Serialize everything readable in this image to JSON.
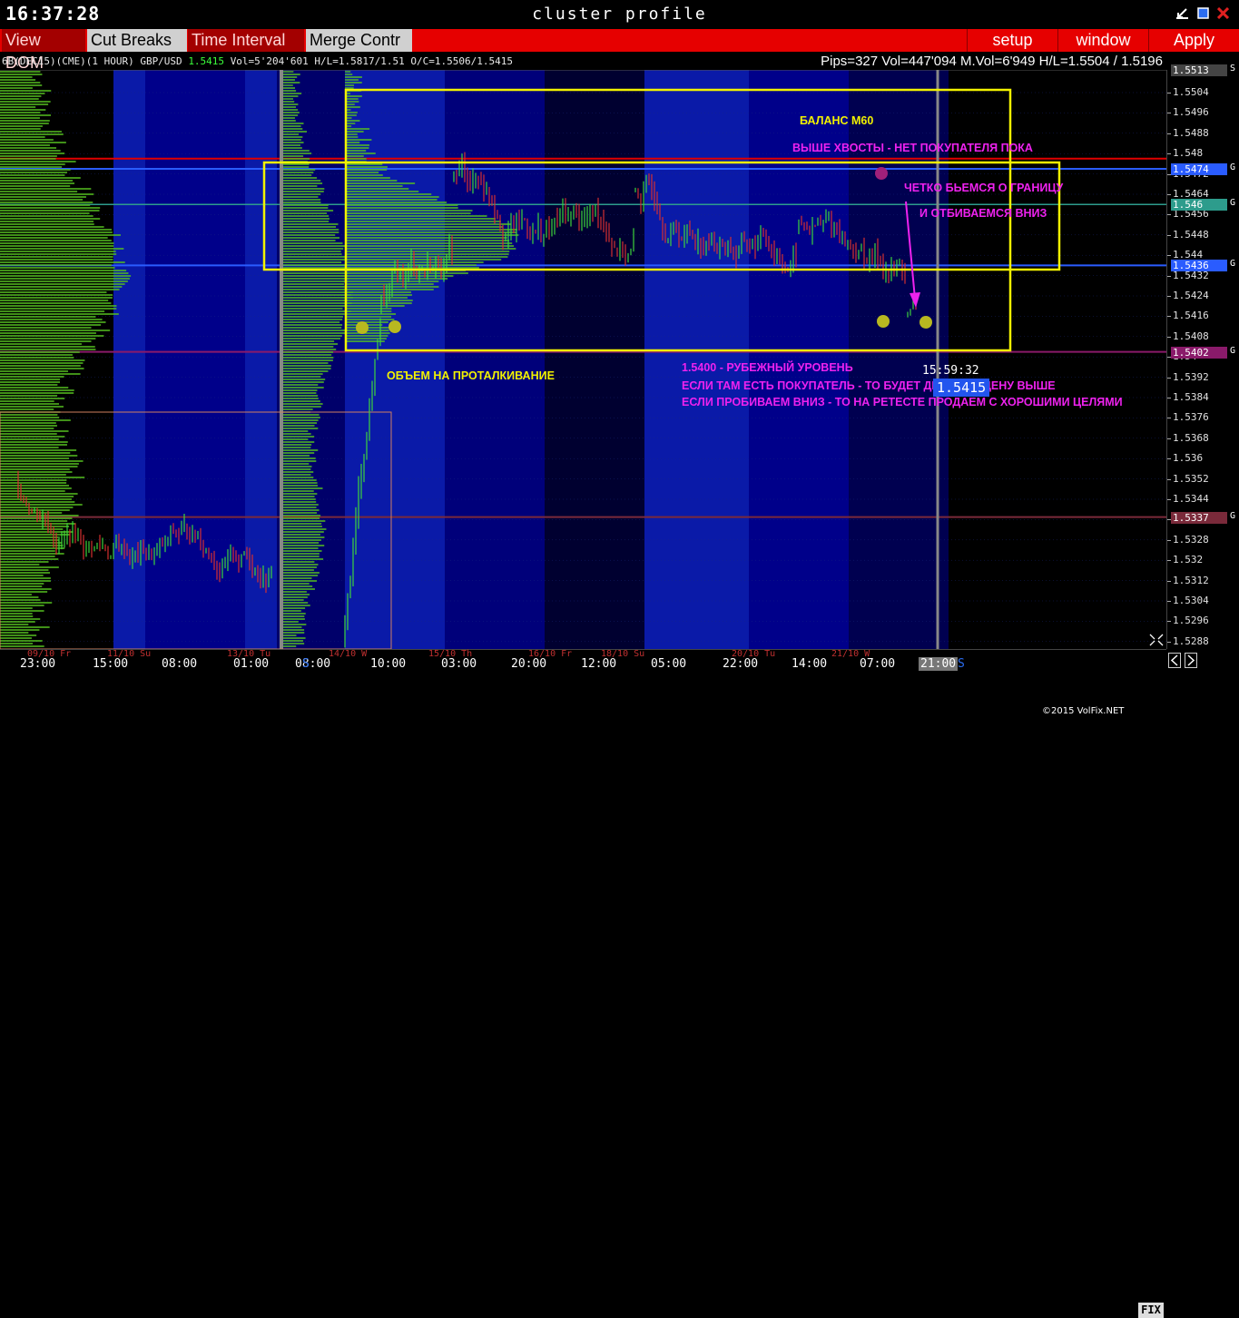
{
  "window": {
    "clock": "16:37:28",
    "title": "cluster profile"
  },
  "menu": {
    "view_dom": "View DOM",
    "cut_breaks": "Cut Breaks",
    "time_interval": "Time Interval",
    "merge_contr": "Merge Contr",
    "setup": "setup",
    "window": "window",
    "apply": "Apply"
  },
  "info": {
    "symbol": "6B(DEC15)(CME)(1 HOUR) GBP/USD",
    "last": "1.5415",
    "stats": "Vol=5'204'601 H/L=1.5817/1.51 O/C=1.5506/1.5415",
    "right": "Pips=327 Vol=447'094 M.Vol=6'949 H/L=1.5504 / 1.5196"
  },
  "yaxis": {
    "ticks": [
      "1.5504",
      "1.5496",
      "1.5488",
      "1.548",
      "1.5472",
      "1.5464",
      "1.5456",
      "1.5448",
      "1.544",
      "1.5432",
      "1.5424",
      "1.5416",
      "1.5408",
      "1.54",
      "1.5392",
      "1.5384",
      "1.5376",
      "1.5368",
      "1.536",
      "1.5352",
      "1.5344",
      "1.5336",
      "1.5328",
      "1.532",
      "1.5312",
      "1.5304",
      "1.5296",
      "1.5288"
    ],
    "levels": [
      {
        "text": "1.5513",
        "color": "#444444",
        "suffix": "S"
      },
      {
        "text": "1.5474",
        "color": "#2a5cff",
        "suffix": "G"
      },
      {
        "text": "1.546",
        "color": "#2d9c8c",
        "suffix": "G"
      },
      {
        "text": "1.5436",
        "color": "#2a5cff",
        "suffix": "G"
      },
      {
        "text": "1.5402",
        "color": "#8a1a6a",
        "suffix": "G"
      },
      {
        "text": "1.5337",
        "color": "#7a2a3a",
        "suffix": "G"
      }
    ]
  },
  "xaxis": {
    "times": [
      "23:00",
      "15:00",
      "08:00",
      "01:00",
      "08:00",
      "10:00",
      "03:00",
      "20:00",
      "12:00",
      "05:00",
      "22:00",
      "14:00",
      "07:00",
      "21:00"
    ],
    "dates": [
      "09/10 Fr",
      "11/10 Su",
      "13/10 Tu",
      "14/10 W",
      "15/10 Th",
      "16/10 Fr",
      "18/10 Su",
      "20/10 Tu",
      "21/10 W"
    ],
    "end_marker": "S",
    "mid_marker": "S"
  },
  "annotations": {
    "balance": "БАЛАНС М60",
    "tails": "ВЫШЕ ХВОСТЫ - НЕТ ПОКУПАТЕЛЯ ПОКА",
    "fight1": "ЧЕТКО БЬЕМСЯ О ГРАНИЦУ",
    "fight2": "И ОТБИВАЕМСЯ ВНИЗ",
    "volume": "ОБЪЕМ НА ПРОТАЛКИВАНИЕ",
    "level1": "1.5400 - РУБЕЖНЫЙ УРОВЕНЬ",
    "level2": "ЕСЛИ ТАМ ЕСТЬ ПОКУПАТЕЛЬ - ТО БУДЕТ ДЕРЖАТЬ ЦЕНУ ВЫШЕ",
    "level3": "ЕСЛИ ПРОБИВАЕМ ВНИЗ - ТО НА РЕТЕСТЕ ПРОДАЕМ С ХОРОШИМИ ЦЕЛЯМИ"
  },
  "current": {
    "time": "15:59:32",
    "price": "1.5415"
  },
  "footer": {
    "copyright": "©2015 VolFix.NET",
    "fix": "FIX"
  }
}
